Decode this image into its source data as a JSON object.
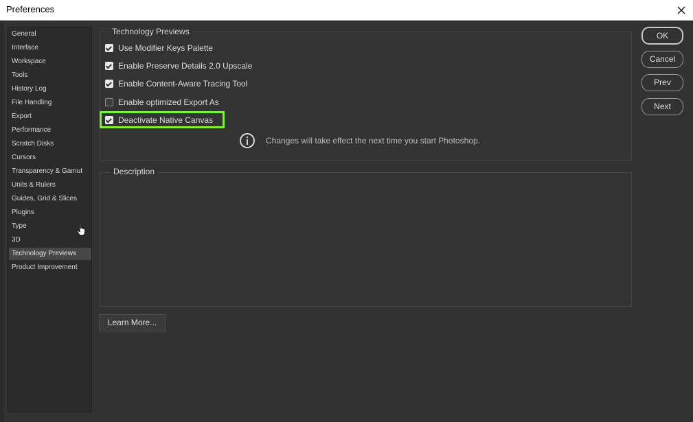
{
  "window": {
    "title": "Preferences"
  },
  "sidebar": {
    "items": [
      {
        "label": "General"
      },
      {
        "label": "Interface"
      },
      {
        "label": "Workspace"
      },
      {
        "label": "Tools"
      },
      {
        "label": "History Log"
      },
      {
        "label": "File Handling"
      },
      {
        "label": "Export"
      },
      {
        "label": "Performance"
      },
      {
        "label": "Scratch Disks"
      },
      {
        "label": "Cursors"
      },
      {
        "label": "Transparency & Gamut"
      },
      {
        "label": "Units & Rulers"
      },
      {
        "label": "Guides, Grid & Slices"
      },
      {
        "label": "Plugins"
      },
      {
        "label": "Type"
      },
      {
        "label": "3D"
      },
      {
        "label": "Technology Previews",
        "active": true
      },
      {
        "label": "Product Improvement"
      }
    ]
  },
  "tech_previews": {
    "heading": "Technology Previews",
    "options": [
      {
        "label": "Use Modifier Keys Palette",
        "checked": true
      },
      {
        "label": "Enable Preserve Details 2.0 Upscale",
        "checked": true
      },
      {
        "label": "Enable Content-Aware Tracing Tool",
        "checked": true
      },
      {
        "label": "Enable optimized Export As",
        "checked": false
      },
      {
        "label": "Deactivate Native Canvas",
        "checked": true,
        "highlighted": true
      }
    ],
    "info_icon": "info-circle-icon",
    "info_text": "Changes will take effect the next time you start Photoshop."
  },
  "description": {
    "heading": "Description"
  },
  "learn_more_label": "Learn More...",
  "buttons": {
    "ok": "OK",
    "cancel": "Cancel",
    "prev": "Prev",
    "next": "Next"
  },
  "colors": {
    "highlight": "#7cf235",
    "panel_bg": "#323232"
  }
}
